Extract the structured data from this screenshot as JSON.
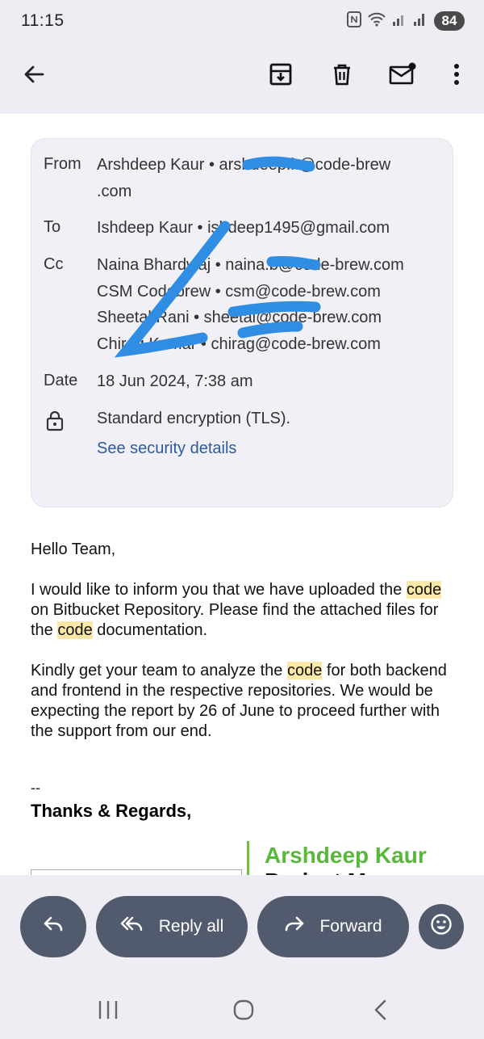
{
  "status_bar": {
    "time": "11:15",
    "battery": "84"
  },
  "toolbar": {
    "back": "back-arrow-icon",
    "archive": "archive-icon",
    "delete": "delete-icon",
    "unread": "mark-unread-icon",
    "more": "more-vert-icon"
  },
  "details": {
    "from_label": "From",
    "from_value_line1": "Arshdeep Kaur • arshdeep.k@code-brew",
    "from_value_line2": ".com",
    "to_label": "To",
    "to_value": "Ishdeep Kaur • ishdeep1495@gmail.com",
    "cc_label": "Cc",
    "cc_values": [
      "Naina Bhardwaj • naina.b@code-brew.com",
      "CSM Codebrew • csm@code-brew.com",
      "Sheetal Rani • sheetal@code-brew.com",
      "Chirag Kumar • chirag@code-brew.com"
    ],
    "date_label": "Date",
    "date_value": "18 Jun 2024, 7:38 am",
    "encryption": "Standard encryption (TLS).",
    "security_link": "See security details"
  },
  "message": {
    "greeting": "Hello Team,",
    "p1_a": "I would like to inform you that we have uploaded the ",
    "p1_hl1": "code",
    "p1_b": " on Bitbucket Repository. Please find the attached files for the ",
    "p1_hl2": "code",
    "p1_c": " documentation.",
    "p2_a": "Kindly get your team to analyze the ",
    "p2_hl": "code",
    "p2_b": " for both backend and frontend in the respective repositories. We would be expecting the report by 26 of June to proceed further with the support from our end."
  },
  "signature": {
    "dash": "--",
    "thanks": "Thanks & Regards,",
    "name": "Arshdeep Kaur",
    "role": "Project Manager"
  },
  "actions": {
    "reply": "",
    "reply_all": "Reply all",
    "forward": "Forward"
  },
  "colors": {
    "accent_link": "#2d5aa0",
    "highlight": "#fce8a6",
    "signature_green": "#58b83a",
    "pill_bg": "#525a6e",
    "redaction": "#2f8de4"
  }
}
